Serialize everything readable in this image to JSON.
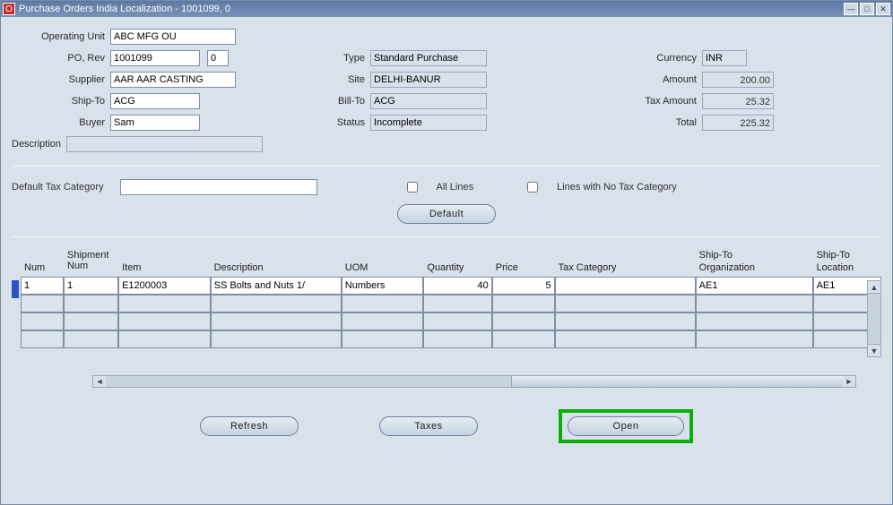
{
  "window": {
    "title": "Purchase Orders India Localization - 1001099, 0"
  },
  "header": {
    "labels": {
      "operating_unit": "Operating Unit",
      "po_rev": "PO, Rev",
      "supplier": "Supplier",
      "ship_to": "Ship-To",
      "buyer": "Buyer",
      "description": "Description",
      "type": "Type",
      "site": "Site",
      "bill_to": "Bill-To",
      "status": "Status",
      "currency": "Currency",
      "amount": "Amount",
      "tax_amount": "Tax Amount",
      "total": "Total"
    },
    "values": {
      "operating_unit": "ABC MFG OU",
      "po": "1001099",
      "rev": "0",
      "supplier": "AAR AAR CASTING",
      "ship_to": "ACG",
      "buyer": "Sam",
      "description": "",
      "type": "Standard Purchase",
      "site": "DELHI-BANUR",
      "bill_to": "ACG",
      "status": "Incomplete",
      "currency": "INR",
      "amount": "200.00",
      "tax_amount": "25.32",
      "total": "225.32"
    }
  },
  "taxcat": {
    "label": "Default Tax Category",
    "value": "",
    "all_lines_label": "All Lines",
    "no_tax_label": "Lines with No Tax Category",
    "default_btn": "Default"
  },
  "grid": {
    "columns": {
      "num": "Num",
      "shipment_num_upper": "Shipment Num",
      "item": "Item",
      "description": "Description",
      "uom": "UOM",
      "quantity": "Quantity",
      "price": "Price",
      "tax_category": "Tax Category",
      "ship_to_org_upper": "Ship-To",
      "ship_to_org": "Organization",
      "ship_to_loc_upper": "Ship-To",
      "ship_to_loc": "Location"
    },
    "rows": [
      {
        "num": "1",
        "shipnum": "1",
        "item": "E1200003",
        "desc": "SS Bolts and Nuts 1/",
        "uom": "Numbers",
        "qty": "40",
        "price": "5",
        "taxcat": "",
        "shiporg": "AE1",
        "shiploc": "AE1"
      }
    ]
  },
  "buttons": {
    "refresh": "Refresh",
    "taxes": "Taxes",
    "open": "Open"
  }
}
